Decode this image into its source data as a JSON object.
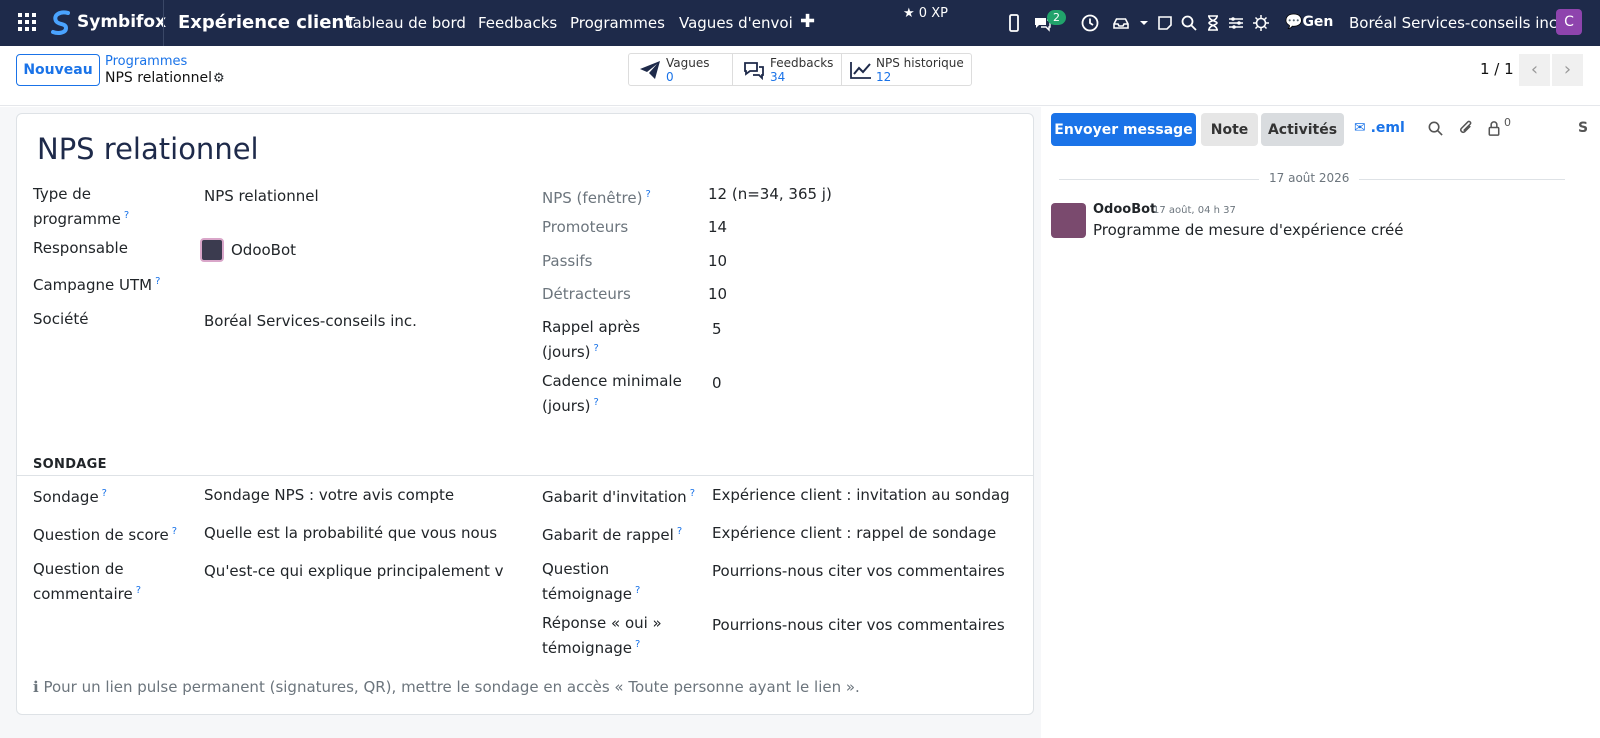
{
  "navbar": {
    "brand": "Symbifox",
    "app_name": "Expérience client",
    "menu": [
      "Tableau de bord",
      "Feedbacks",
      "Programmes",
      "Vagues d'envoi"
    ],
    "xp": "0 XP",
    "messages_badge": "2",
    "gen_label": "Gen",
    "company": "Boréal Services-conseils inc.",
    "user_initial": "C"
  },
  "control_panel": {
    "new_button": "Nouveau",
    "breadcrumb_parent": "Programmes",
    "breadcrumb_current": "NPS relationnel",
    "stats": [
      {
        "label": "Vagues",
        "value": "0"
      },
      {
        "label": "Feedbacks",
        "value": "34"
      },
      {
        "label": "NPS historique",
        "value": "12"
      }
    ],
    "pager": "1 / 1"
  },
  "form": {
    "title": "NPS relationnel",
    "left_fields": [
      {
        "label": "Type de programme",
        "value": "NPS relationnel"
      },
      {
        "label": "Responsable",
        "value": "OdooBot"
      },
      {
        "label": "Campagne UTM",
        "value": ""
      },
      {
        "label": "Société",
        "value": "Boréal Services-conseils inc."
      }
    ],
    "right_fields": [
      {
        "label": "NPS (fenêtre)",
        "value": "12 (n=34, 365 j)"
      },
      {
        "label": "Promoteurs",
        "value": "14"
      },
      {
        "label": "Passifs",
        "value": "10"
      },
      {
        "label": "Détracteurs",
        "value": "10"
      },
      {
        "label": "Rappel après (jours)",
        "value": "5"
      },
      {
        "label": "Cadence minimale (jours)",
        "value": "0"
      }
    ],
    "section_title": "SONDAGE",
    "survey_left": [
      {
        "label": "Sondage",
        "value": "Sondage NPS : votre avis compte"
      },
      {
        "label": "Question de score",
        "value": "Quelle est la probabilité que vous nous"
      },
      {
        "label": "Question de commentaire",
        "value": "Qu'est-ce qui explique principalement v"
      }
    ],
    "survey_right": [
      {
        "label": "Gabarit d'invitation",
        "value": "Expérience client : invitation au sondag"
      },
      {
        "label": "Gabarit de rappel",
        "value": "Expérience client : rappel de sondage"
      },
      {
        "label": "Question témoignage",
        "value": "Pourrions-nous citer vos commentaires"
      },
      {
        "label": "Réponse « oui » témoignage",
        "value": "Pourrions-nous citer vos commentaires"
      }
    ],
    "hint": "Pour un lien pulse permanent (signatures, QR), mettre le sondage en accès « Toute personne ayant le lien »."
  },
  "chatter": {
    "send_button": "Envoyer message",
    "note_button": "Note",
    "activities_button": "Activités",
    "eml_label": ".eml",
    "followers_count": "0",
    "follow_label": "S",
    "date_separator": "17 août 2026",
    "message": {
      "author": "OdooBot",
      "date": "17 août, 04 h 37",
      "body": "Programme de mesure d'expérience créé"
    }
  },
  "colors": {
    "navbar": "#1e2a4a",
    "primary": "#1a73e8",
    "badge": "#21a36b",
    "avatar": "#8e44ad"
  }
}
